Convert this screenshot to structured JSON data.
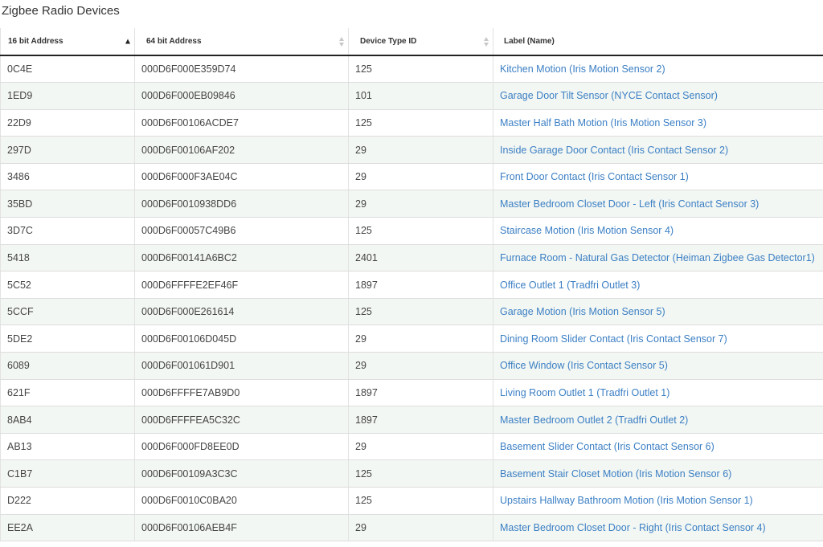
{
  "page": {
    "title": "Zigbee Radio Devices"
  },
  "table": {
    "columns": [
      {
        "label": "16 bit Address",
        "sort": "asc"
      },
      {
        "label": "64 bit Address",
        "sort": "none"
      },
      {
        "label": "Device Type ID",
        "sort": "none"
      },
      {
        "label": "Label (Name)",
        "sort": "none"
      }
    ],
    "rows": [
      {
        "addr16": "0C4E",
        "addr64": "000D6F000E359D74",
        "type_id": "125",
        "label": "Kitchen Motion (Iris Motion Sensor 2)"
      },
      {
        "addr16": "1ED9",
        "addr64": "000D6F000EB09846",
        "type_id": "101",
        "label": "Garage Door Tilt Sensor (NYCE Contact Sensor)"
      },
      {
        "addr16": "22D9",
        "addr64": "000D6F00106ACDE7",
        "type_id": "125",
        "label": "Master Half Bath Motion (Iris Motion Sensor 3)"
      },
      {
        "addr16": "297D",
        "addr64": "000D6F00106AF202",
        "type_id": "29",
        "label": "Inside Garage Door Contact (Iris Contact Sensor 2)"
      },
      {
        "addr16": "3486",
        "addr64": "000D6F000F3AE04C",
        "type_id": "29",
        "label": "Front Door Contact (Iris Contact Sensor 1)"
      },
      {
        "addr16": "35BD",
        "addr64": "000D6F0010938DD6",
        "type_id": "29",
        "label": "Master Bedroom Closet Door - Left (Iris Contact Sensor 3)"
      },
      {
        "addr16": "3D7C",
        "addr64": "000D6F00057C49B6",
        "type_id": "125",
        "label": "Staircase Motion (Iris Motion Sensor 4)"
      },
      {
        "addr16": "5418",
        "addr64": "000D6F00141A6BC2",
        "type_id": "2401",
        "label": "Furnace Room - Natural Gas Detector (Heiman Zigbee Gas Detector1)"
      },
      {
        "addr16": "5C52",
        "addr64": "000D6FFFFE2EF46F",
        "type_id": "1897",
        "label": "Office Outlet 1 (Tradfri Outlet 3)"
      },
      {
        "addr16": "5CCF",
        "addr64": "000D6F000E261614",
        "type_id": "125",
        "label": "Garage Motion (Iris Motion Sensor 5)"
      },
      {
        "addr16": "5DE2",
        "addr64": "000D6F00106D045D",
        "type_id": "29",
        "label": "Dining Room Slider Contact (Iris Contact Sensor 7)"
      },
      {
        "addr16": "6089",
        "addr64": "000D6F001061D901",
        "type_id": "29",
        "label": "Office Window (Iris Contact Sensor 5)"
      },
      {
        "addr16": "621F",
        "addr64": "000D6FFFFE7AB9D0",
        "type_id": "1897",
        "label": "Living Room Outlet 1 (Tradfri Outlet 1)"
      },
      {
        "addr16": "8AB4",
        "addr64": "000D6FFFFEA5C32C",
        "type_id": "1897",
        "label": "Master Bedroom Outlet 2 (Tradfri Outlet 2)"
      },
      {
        "addr16": "AB13",
        "addr64": "000D6F000FD8EE0D",
        "type_id": "29",
        "label": "Basement Slider Contact (Iris Contact Sensor 6)"
      },
      {
        "addr16": "C1B7",
        "addr64": "000D6F00109A3C3C",
        "type_id": "125",
        "label": "Basement Stair Closet Motion (Iris Motion Sensor 6)"
      },
      {
        "addr16": "D222",
        "addr64": "000D6F0010C0BA20",
        "type_id": "125",
        "label": "Upstairs Hallway Bathroom Motion (Iris Motion Sensor 1)"
      },
      {
        "addr16": "EE2A",
        "addr64": "000D6F00106AEB4F",
        "type_id": "29",
        "label": "Master Bedroom Closet Door - Right (Iris Contact Sensor 4)"
      }
    ]
  },
  "colors": {
    "link": "#3b7fc4",
    "row_stripe": "#f3f7f3",
    "header_border": "#222222"
  }
}
